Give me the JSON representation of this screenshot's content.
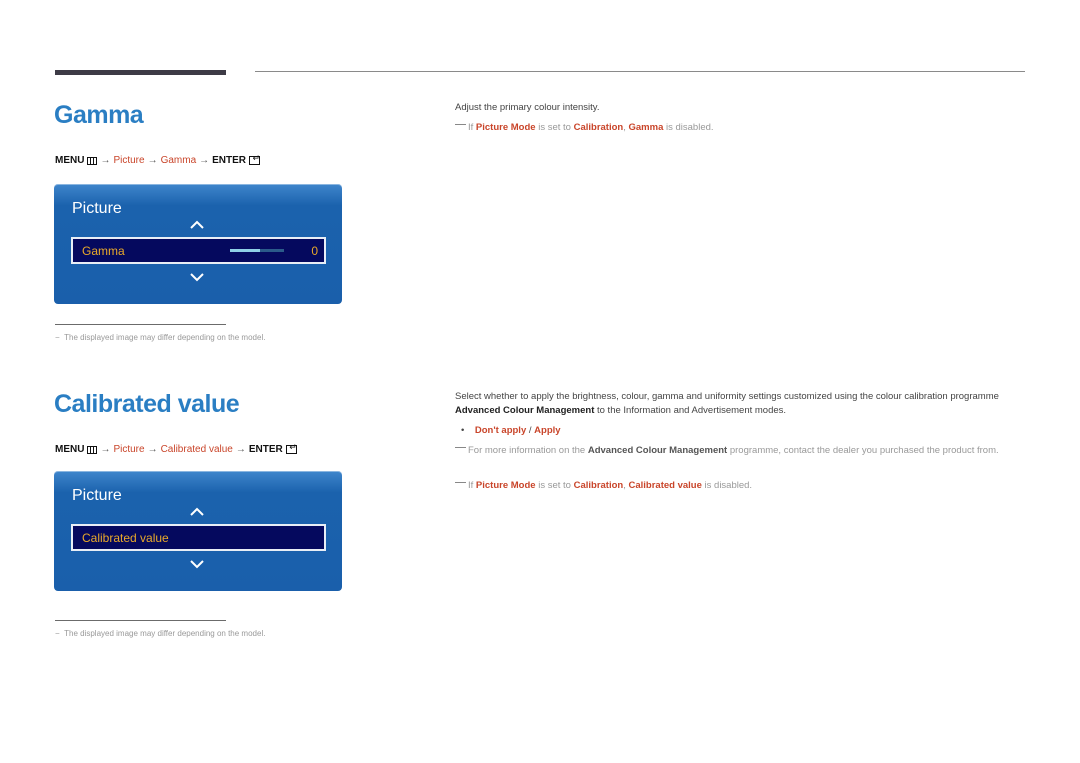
{
  "header": {
    "rule": "section-divider"
  },
  "sections": [
    {
      "title": "Gamma",
      "menu_path": {
        "menu": "MENU",
        "arrow": "→",
        "item1": "Picture",
        "item2": "Gamma",
        "enter": "ENTER"
      },
      "panel": {
        "title": "Picture",
        "selected_label": "Gamma",
        "slider_fraction": 0.55,
        "value": "0"
      },
      "footnote": "The displayed image may differ depending on the model.",
      "footnote_dash": "−",
      "description": "Adjust the primary colour intensity.",
      "note": {
        "prefix": "If ",
        "b1": "Picture Mode",
        "mid1": " is set to ",
        "b2": "Calibration",
        "sep": ", ",
        "b3": "Gamma",
        "suffix": " is disabled."
      }
    },
    {
      "title": "Calibrated value",
      "menu_path": {
        "menu": "MENU",
        "arrow": "→",
        "item1": "Picture",
        "item2": "Calibrated value",
        "enter": "ENTER"
      },
      "panel": {
        "title": "Picture",
        "selected_label": "Calibrated value"
      },
      "footnote": "The displayed image may differ depending on the model.",
      "footnote_dash": "−",
      "description": {
        "part1": "Select whether to apply the brightness, colour, gamma and uniformity settings customized using the colour calibration programme ",
        "bold": "Advanced Colour Management",
        "part2": " to the Information and Advertisement modes."
      },
      "options": {
        "bullet": "•",
        "opt1": "Don't apply",
        "sep": " / ",
        "opt2": "Apply"
      },
      "note1": {
        "prefix": "For more information on the ",
        "bold": "Advanced Colour Management",
        "suffix": " programme, contact the dealer you purchased the product from."
      },
      "note2": {
        "prefix": "If ",
        "b1": "Picture Mode",
        "mid1": " is set to ",
        "b2": "Calibration",
        "sep": ", ",
        "b3": "Calibrated value",
        "suffix": " is disabled."
      }
    }
  ],
  "colors": {
    "heading": "#2a7ec3",
    "highlight": "#c9452a",
    "panel": "#1a5fab",
    "selected_row": "#05095e",
    "selected_text": "#e9a92a"
  }
}
